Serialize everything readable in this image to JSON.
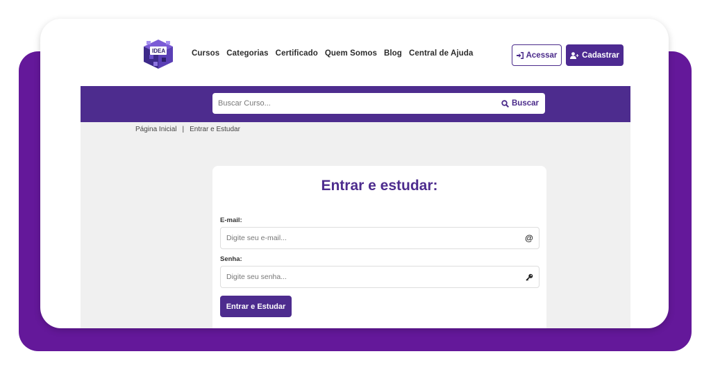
{
  "header": {
    "logo": {
      "icon": "cube-logo-icon",
      "text": "IDEA"
    },
    "nav": [
      "Cursos",
      "Categorias",
      "Certificado",
      "Quem Somos",
      "Blog",
      "Central de Ajuda"
    ],
    "login_button": {
      "label": "Acessar",
      "icon": "sign-in-icon"
    },
    "register_button": {
      "label": "Cadastrar",
      "icon": "user-plus-icon"
    }
  },
  "search": {
    "placeholder": "Buscar Curso...",
    "button_label": "Buscar",
    "button_icon": "search-icon"
  },
  "breadcrumb": {
    "home": "Página Inicial",
    "separator": "|",
    "current": "Entrar e Estudar"
  },
  "login_form": {
    "title": "Entrar e estudar:",
    "email_label": "E-mail:",
    "email_placeholder": "Digite seu e-mail...",
    "email_icon": "at-sign-icon",
    "password_label": "Senha:",
    "password_placeholder": "Digite seu senha...",
    "password_icon": "key-icon",
    "submit_label": "Entrar e Estudar"
  },
  "colors": {
    "brand_purple": "#4d2c8e",
    "frame_purple": "#64189a",
    "content_bg": "#f0f0f0"
  }
}
